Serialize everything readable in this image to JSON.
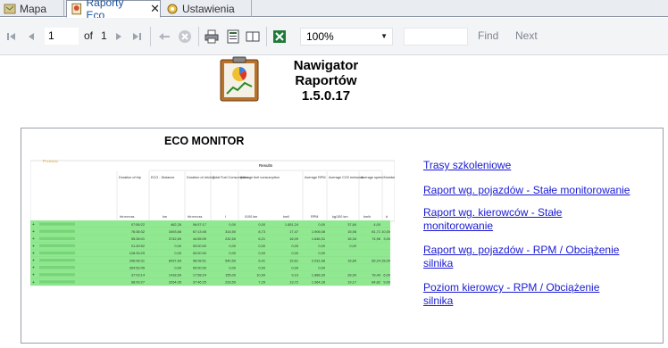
{
  "tabs": [
    {
      "label": "Mapa",
      "active": false
    },
    {
      "label": "Raporty Eco",
      "active": true
    },
    {
      "label": "Ustawienia",
      "active": false
    }
  ],
  "toolbar": {
    "page_value": "1",
    "of_label": "of",
    "total_pages": "1",
    "zoom_value": "100%",
    "find_label": "Find",
    "next_label": "Next"
  },
  "header": {
    "title_line1": "Nawigator",
    "title_line2": "Raportów",
    "version": "1.5.0.17"
  },
  "report": {
    "title": "ECO MONITOR",
    "preview_label": "Przewoz",
    "results_label": "Results",
    "columns": [
      "Duration of trip",
      "ECO - Distance",
      "Duration of driving",
      "Total Fuel Consumption",
      "Average fuel consumption",
      "Average RPM",
      "Average CO2 emission",
      "Average speed",
      "Number of long idling"
    ],
    "units": [
      "hh:mm:ss",
      "km",
      "hh:mm:ss",
      "l",
      "l/100 km",
      "km/l",
      "RPM",
      "kg/100 km",
      "km/h",
      "#"
    ],
    "rows": [
      [
        "07:58:22",
        "462,26",
        "06:57:17",
        "0,00",
        "0,00",
        "1.851,24",
        "0,00",
        "37,84",
        "4,00"
      ],
      [
        "76:38:32",
        "3493,66",
        "67:13:45",
        "314,50",
        "8,73",
        "17,47",
        "1.906,08",
        "15,06",
        "81,71",
        "10,00"
      ],
      [
        "55:38:01",
        "3742,69",
        "44:55:09",
        "232,50",
        "6,21",
        "16,09",
        "1.646,31",
        "16,34",
        "74,96",
        "3,00"
      ],
      [
        "01:49:52",
        "0,00",
        "00:00:00",
        "0,00",
        "0,00",
        "0,00",
        "0,00",
        "0,00"
      ],
      [
        "128:33:29",
        "0,00",
        "00:00:00",
        "0,00",
        "0,00",
        "0,00",
        "0,00"
      ],
      [
        "206:08:31",
        "8437,69",
        "98:08:51",
        "540,50",
        "6,41",
        "15,61",
        "2.031,68",
        "16,89",
        "85,24",
        "28,00"
      ],
      [
        "264:53:45",
        "0,00",
        "00:00:00",
        "0,00",
        "0,00",
        "0,00",
        "0,00"
      ],
      [
        "37:03:14",
        "1418,59",
        "17:58:24",
        "155,00",
        "10,99",
        "9,10",
        "1.888,39",
        "28,90",
        "78,49",
        "6,00"
      ],
      [
        "68:09:27",
        "3264,05",
        "37:46:25",
        "233,50",
        "7,29",
        "13,72",
        "1.964,28",
        "19,17",
        "84,82",
        "9,00"
      ]
    ]
  },
  "links": [
    "Trasy szkoleniowe",
    "Raport wg. pojazdów - Stałe monitorowanie",
    "Raport wg. kierowców - Stałe monitorowanie",
    "Raport wg. pojazdów - RPM / Obciążenie silnika",
    "Poziom kierowcy - RPM / Obciążenie silnika"
  ],
  "colors": {
    "row_green": "#90e890",
    "link": "#1a1ad4",
    "excel_green": "#1f7a3a"
  }
}
